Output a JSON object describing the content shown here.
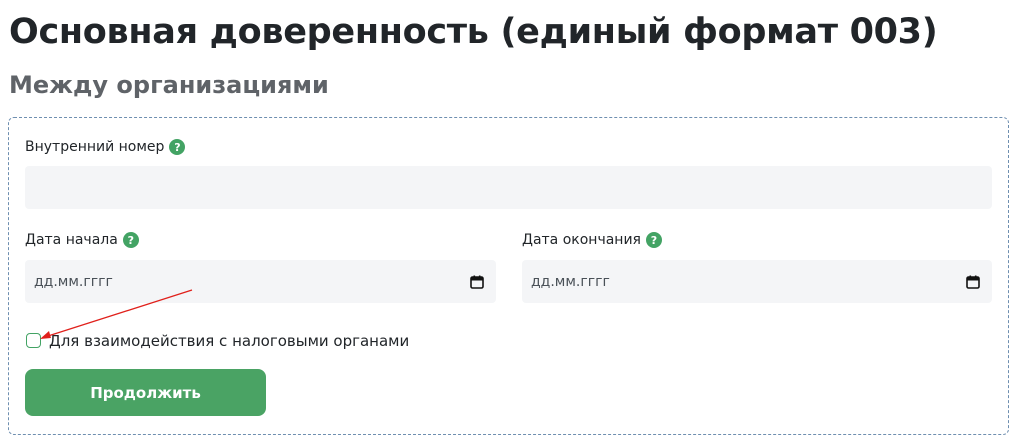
{
  "page": {
    "title": "Основная доверенность (единый формат 003)",
    "subtitle": "Между организациями"
  },
  "form": {
    "internal_number": {
      "label": "Внутренний номер",
      "value": "",
      "placeholder": ""
    },
    "start_date": {
      "label": "Дата начала",
      "placeholder": "дд.мм.гггг"
    },
    "end_date": {
      "label": "Дата окончания",
      "placeholder": "дд.мм.гггг"
    },
    "tax_checkbox": {
      "label": "Для взаимодействия с налоговыми органами",
      "checked": false
    },
    "submit_label": "Продолжить"
  },
  "icons": {
    "help": "question-mark-icon",
    "calendar": "calendar-icon"
  },
  "colors": {
    "accent": "#43a364",
    "button": "#4aa364",
    "field_bg": "#f4f5f7",
    "annotation": "#e0201b",
    "card_border": "#6f8fb0"
  }
}
